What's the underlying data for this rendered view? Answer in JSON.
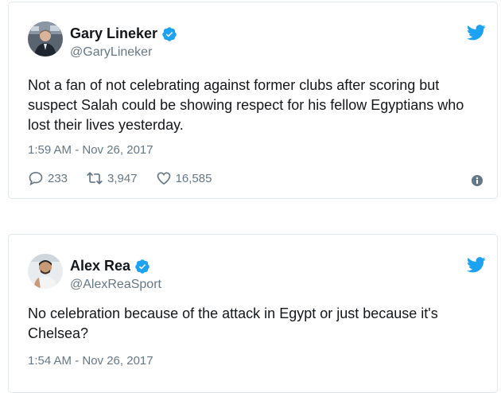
{
  "tweets": [
    {
      "display_name": "Gary Lineker",
      "handle": "@GaryLineker",
      "text": "Not a fan of not celebrating against former clubs after scoring but suspect Salah could be showing respect for his fellow Egyptians who lost their lives yesterday.",
      "timestamp": "1:59 AM - Nov 26, 2017",
      "replies": "233",
      "retweets": "3,947",
      "likes": "16,585",
      "verified": true
    },
    {
      "display_name": "Alex Rea",
      "handle": "@AlexReaSport",
      "text": "No celebration because of the attack in Egypt or just because it's Chelsea?",
      "timestamp": "1:54 AM - Nov 26, 2017",
      "verified": true
    }
  ],
  "colors": {
    "twitter_blue": "#1da1f2",
    "text_primary": "#14171a",
    "text_secondary": "#657786",
    "border": "#e1e8ed"
  },
  "icons": {
    "bird": "twitter-bird-icon",
    "verified": "verified-badge-icon",
    "reply": "reply-icon",
    "retweet": "retweet-icon",
    "like": "heart-icon",
    "info": "info-icon"
  }
}
